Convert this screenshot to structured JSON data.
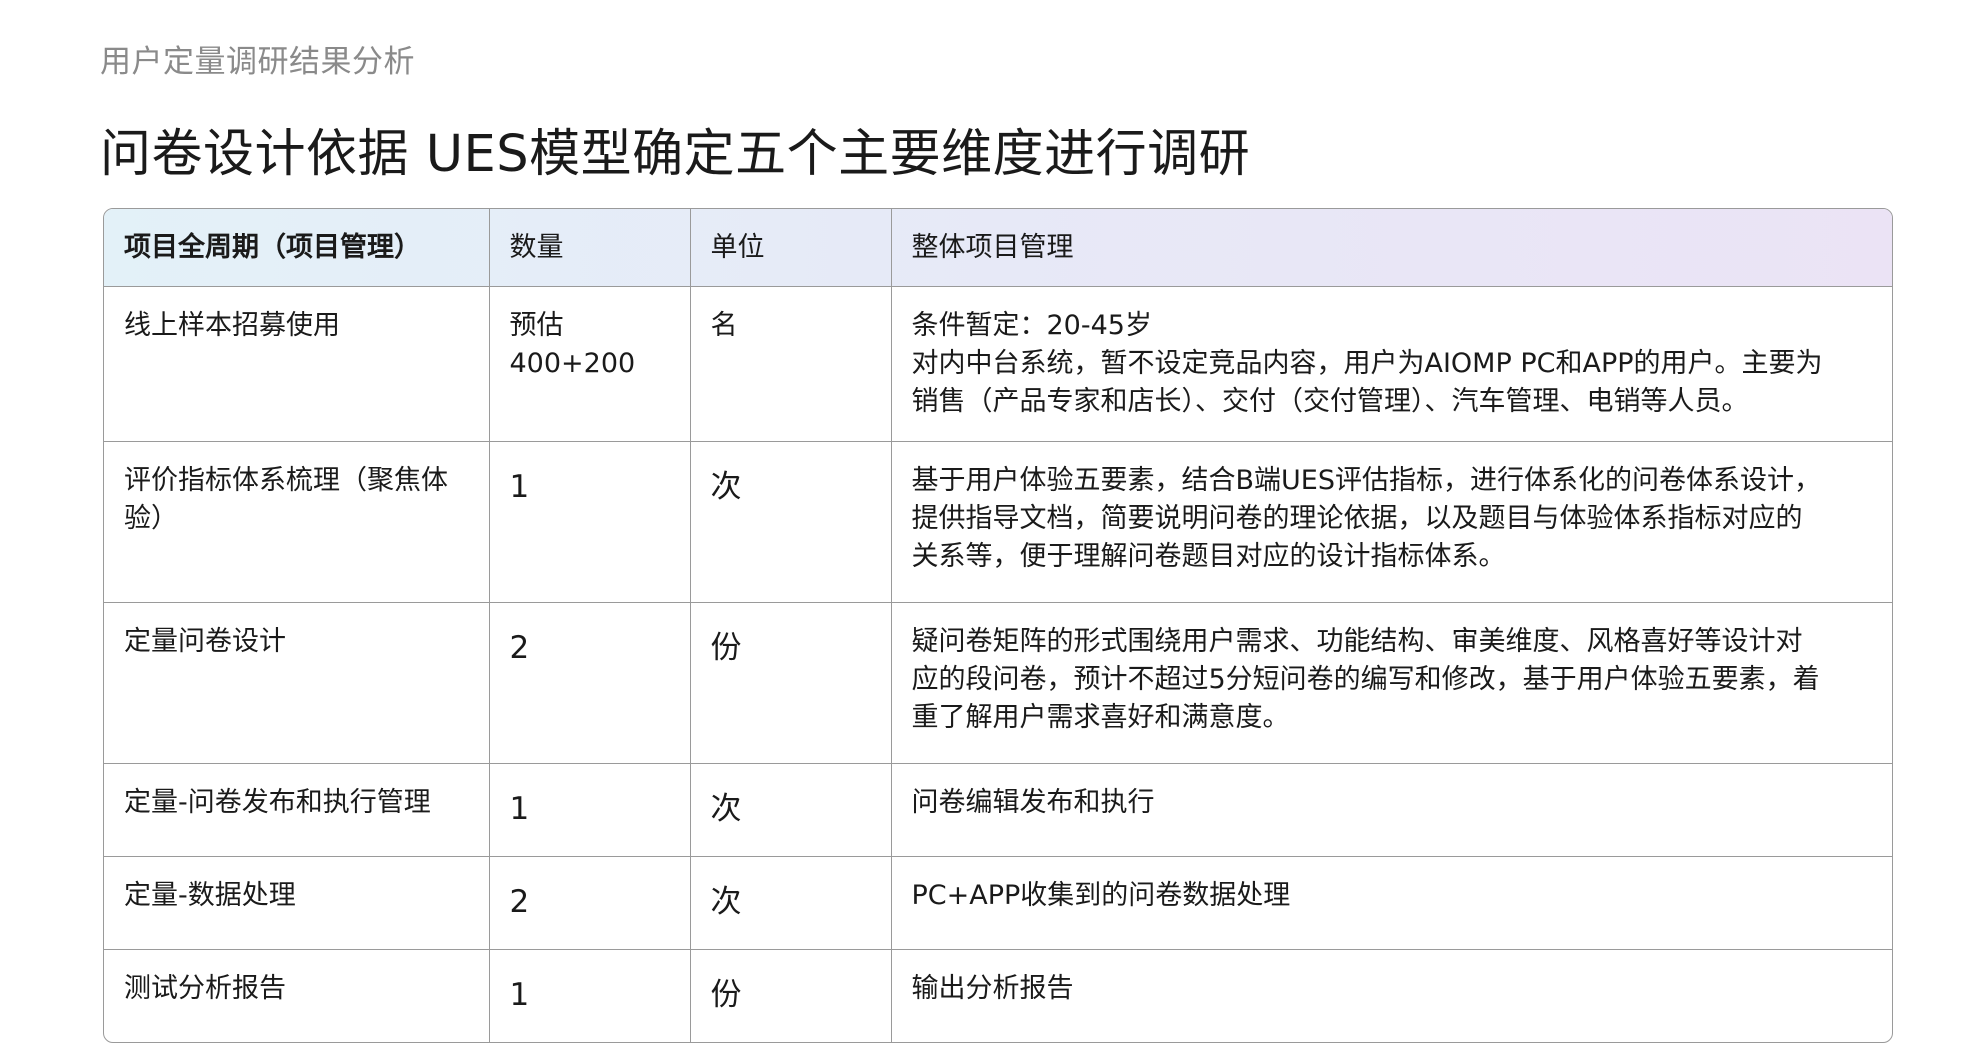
{
  "page": {
    "subtitle": "用户定量调研结果分析",
    "title": "问卷设计依据 UES模型确定五个主要维度进行调研"
  },
  "table": {
    "headers": [
      "项目全周期（项目管理）",
      "数量",
      "单位",
      "整体项目管理"
    ],
    "rows": [
      {
        "item": "线上样本招募使用",
        "quantity": [
          "预估",
          "400+200"
        ],
        "unit": "名",
        "description": [
          "条件暂定：20-45岁",
          "对内中台系统，暂不设定竞品内容，用户为AIOMP PC和APP的用户。主要为",
          "销售（产品专家和店长）、交付（交付管理）、汽车管理、电销等人员。"
        ]
      },
      {
        "item": "评价指标体系梳理（聚焦体验）",
        "quantity": [
          "1"
        ],
        "unit": "次",
        "description": [
          "基于用户体验五要素，结合B端UES评估指标，进行体系化的问卷体系设计，",
          "提供指导文档，简要说明问卷的理论依据，以及题目与体验体系指标对应的",
          "关系等，便于理解问卷题目对应的设计指标体系。"
        ]
      },
      {
        "item": "定量问卷设计",
        "quantity": [
          "2"
        ],
        "unit": "份",
        "description": [
          "疑问卷矩阵的形式围绕用户需求、功能结构、审美维度、风格喜好等设计对",
          "应的段问卷，预计不超过5分短问卷的编写和修改，基于用户体验五要素，着",
          "重了解用户需求喜好和满意度。"
        ]
      },
      {
        "item": "定量-问卷发布和执行管理",
        "quantity": [
          "1"
        ],
        "unit": "次",
        "description": [
          "问卷编辑发布和执行"
        ]
      },
      {
        "item": "定量-数据处理",
        "quantity": [
          "2"
        ],
        "unit": "次",
        "description": [
          "PC+APP收集到的问卷数据处理"
        ]
      },
      {
        "item": "测试分析报告",
        "quantity": [
          "1"
        ],
        "unit": "份",
        "description": [
          "输出分析报告"
        ]
      }
    ]
  }
}
